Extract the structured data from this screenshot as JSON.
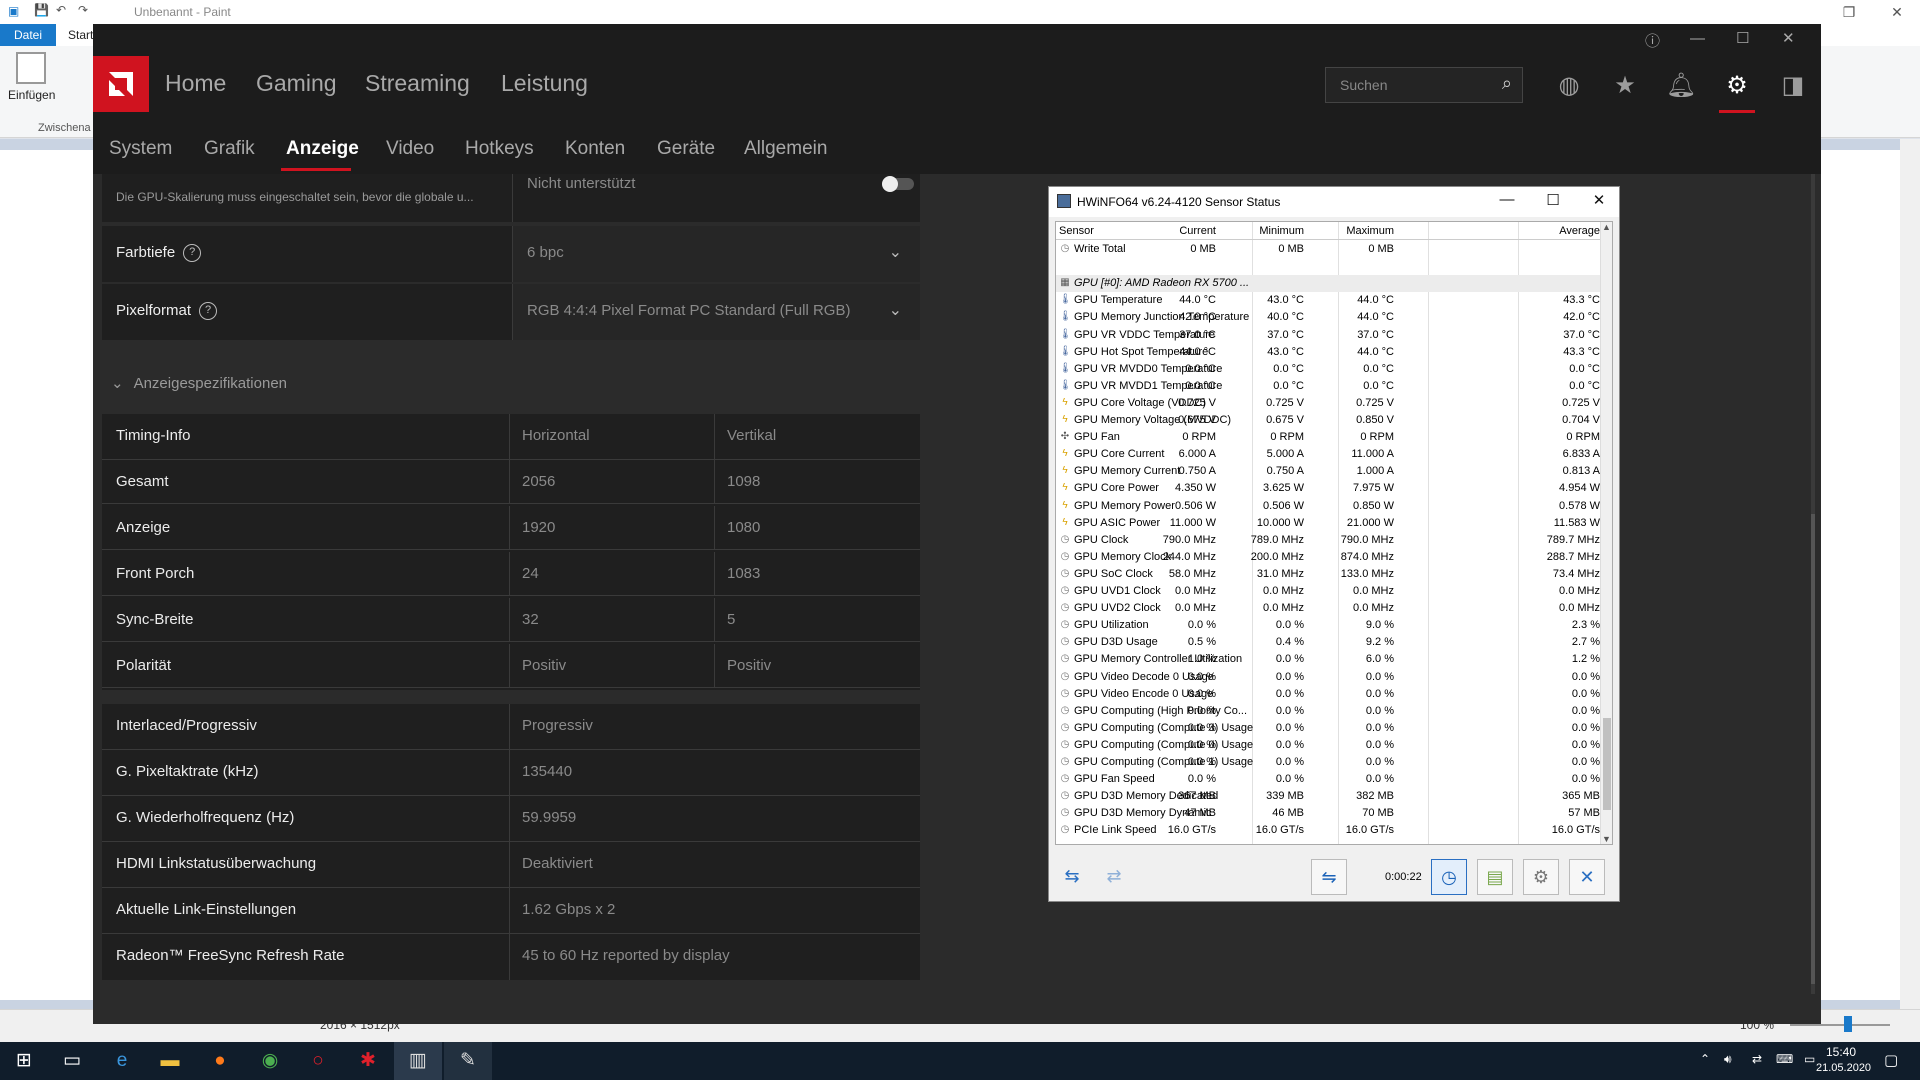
{
  "paint": {
    "title": "Unbenannt - Paint",
    "tab_file": "Datei",
    "tab_start": "Start",
    "paste_label": "Einfügen",
    "clipboard_label": "Zwischena",
    "status_size": "2016 × 1512px",
    "zoom": "100 %"
  },
  "amd": {
    "nav": [
      "Home",
      "Gaming",
      "Streaming",
      "Leistung"
    ],
    "search_placeholder": "Suchen",
    "subnav": [
      "System",
      "Grafik",
      "Anzeige",
      "Video",
      "Hotkeys",
      "Konten",
      "Geräte",
      "Allgemein"
    ],
    "scaling_hint": "Die GPU-Skalierung muss eingeschaltet sein, bevor die globale u...",
    "scaling_value": "Nicht unterstützt",
    "color_depth_label": "Farbtiefe",
    "color_depth_value": "6 bpc",
    "pixel_format_label": "Pixelformat",
    "pixel_format_value": "RGB 4:4:4 Pixel Format PC Standard (Full RGB)",
    "specs_header": "Anzeigespezifikationen",
    "timing": {
      "header": [
        "Timing-Info",
        "Horizontal",
        "Vertikal"
      ],
      "rows": [
        [
          "Gesamt",
          "2056",
          "1098"
        ],
        [
          "Anzeige",
          "1920",
          "1080"
        ],
        [
          "Front Porch",
          "24",
          "1083"
        ],
        [
          "Sync-Breite",
          "32",
          "5"
        ],
        [
          "Polarität",
          "Positiv",
          "Positiv"
        ]
      ]
    },
    "details": [
      [
        "Interlaced/Progressiv",
        "Progressiv"
      ],
      [
        "G. Pixeltaktrate (kHz)",
        "135440"
      ],
      [
        "G. Wiederholfrequenz (Hz)",
        "59.9959"
      ],
      [
        "HDMI Linkstatusüberwachung",
        "Deaktiviert"
      ],
      [
        "Aktuelle Link-Einstellungen",
        "1.62 Gbps x 2"
      ],
      [
        "Radeon™ FreeSync Refresh Rate",
        "45 to 60 Hz reported by display"
      ]
    ]
  },
  "hwinfo": {
    "title": "HWiNFO64 v6.24-4120 Sensor Status",
    "columns": [
      "Sensor",
      "Current",
      "Minimum",
      "Maximum",
      "Average"
    ],
    "rows": [
      {
        "icon": "clock-icon",
        "name": "Write Total",
        "v": [
          "0 MB",
          "0 MB",
          "0 MB",
          ""
        ]
      },
      {
        "icon": "",
        "name": "",
        "v": [
          "",
          "",
          "",
          ""
        ]
      },
      {
        "icon": "chip-icon",
        "name": "GPU [#0]: AMD Radeon RX 5700 ...",
        "v": [
          "",
          "",
          "",
          ""
        ],
        "group": true
      },
      {
        "icon": "thermo-icon",
        "name": "GPU Temperature",
        "v": [
          "44.0 °C",
          "43.0 °C",
          "44.0 °C",
          "43.3 °C"
        ]
      },
      {
        "icon": "thermo-icon",
        "name": "GPU Memory Junction Temperature",
        "v": [
          "42.0 °C",
          "40.0 °C",
          "44.0 °C",
          "42.0 °C"
        ]
      },
      {
        "icon": "thermo-icon",
        "name": "GPU VR VDDC Temperature",
        "v": [
          "37.0 °C",
          "37.0 °C",
          "37.0 °C",
          "37.0 °C"
        ]
      },
      {
        "icon": "thermo-icon",
        "name": "GPU Hot Spot Temperature",
        "v": [
          "44.0 °C",
          "43.0 °C",
          "44.0 °C",
          "43.3 °C"
        ]
      },
      {
        "icon": "thermo-icon",
        "name": "GPU VR MVDD0 Temperature",
        "v": [
          "0.0 °C",
          "0.0 °C",
          "0.0 °C",
          "0.0 °C"
        ]
      },
      {
        "icon": "thermo-icon",
        "name": "GPU VR MVDD1 Temperature",
        "v": [
          "0.0 °C",
          "0.0 °C",
          "0.0 °C",
          "0.0 °C"
        ]
      },
      {
        "icon": "bolt-icon",
        "name": "GPU Core Voltage (VDDC)",
        "v": [
          "0.725 V",
          "0.725 V",
          "0.725 V",
          "0.725 V"
        ]
      },
      {
        "icon": "bolt-icon",
        "name": "GPU Memory Voltage (MVDDC)",
        "v": [
          "0.675 V",
          "0.675 V",
          "0.850 V",
          "0.704 V"
        ]
      },
      {
        "icon": "fan-icon",
        "name": "GPU Fan",
        "v": [
          "0 RPM",
          "0 RPM",
          "0 RPM",
          "0 RPM"
        ]
      },
      {
        "icon": "bolt-icon",
        "name": "GPU Core Current",
        "v": [
          "6.000 A",
          "5.000 A",
          "11.000 A",
          "6.833 A"
        ]
      },
      {
        "icon": "bolt-icon",
        "name": "GPU Memory Current",
        "v": [
          "0.750 A",
          "0.750 A",
          "1.000 A",
          "0.813 A"
        ]
      },
      {
        "icon": "bolt-icon",
        "name": "GPU Core Power",
        "v": [
          "4.350 W",
          "3.625 W",
          "7.975 W",
          "4.954 W"
        ]
      },
      {
        "icon": "bolt-icon",
        "name": "GPU Memory Power",
        "v": [
          "0.506 W",
          "0.506 W",
          "0.850 W",
          "0.578 W"
        ]
      },
      {
        "icon": "bolt-icon",
        "name": "GPU ASIC Power",
        "v": [
          "11.000 W",
          "10.000 W",
          "21.000 W",
          "11.583 W"
        ]
      },
      {
        "icon": "clock-icon",
        "name": "GPU Clock",
        "v": [
          "790.0 MHz",
          "789.0 MHz",
          "790.0 MHz",
          "789.7 MHz"
        ]
      },
      {
        "icon": "clock-icon",
        "name": "GPU Memory Clock",
        "v": [
          "244.0 MHz",
          "200.0 MHz",
          "874.0 MHz",
          "288.7 MHz"
        ]
      },
      {
        "icon": "clock-icon",
        "name": "GPU SoC Clock",
        "v": [
          "58.0 MHz",
          "31.0 MHz",
          "133.0 MHz",
          "73.4 MHz"
        ]
      },
      {
        "icon": "clock-icon",
        "name": "GPU UVD1 Clock",
        "v": [
          "0.0 MHz",
          "0.0 MHz",
          "0.0 MHz",
          "0.0 MHz"
        ]
      },
      {
        "icon": "clock-icon",
        "name": "GPU UVD2 Clock",
        "v": [
          "0.0 MHz",
          "0.0 MHz",
          "0.0 MHz",
          "0.0 MHz"
        ]
      },
      {
        "icon": "clock-icon",
        "name": "GPU Utilization",
        "v": [
          "0.0 %",
          "0.0 %",
          "9.0 %",
          "2.3 %"
        ]
      },
      {
        "icon": "clock-icon",
        "name": "GPU D3D Usage",
        "v": [
          "0.5 %",
          "0.4 %",
          "9.2 %",
          "2.7 %"
        ]
      },
      {
        "icon": "clock-icon",
        "name": "GPU Memory Controller Utilization",
        "v": [
          "1.0 %",
          "0.0 %",
          "6.0 %",
          "1.2 %"
        ]
      },
      {
        "icon": "clock-icon",
        "name": "GPU Video Decode 0 Usage",
        "v": [
          "0.0 %",
          "0.0 %",
          "0.0 %",
          "0.0 %"
        ]
      },
      {
        "icon": "clock-icon",
        "name": "GPU Video Encode 0 Usage",
        "v": [
          "0.0 %",
          "0.0 %",
          "0.0 %",
          "0.0 %"
        ]
      },
      {
        "icon": "clock-icon",
        "name": "GPU Computing (High Priority Co...",
        "v": [
          "0.0 %",
          "0.0 %",
          "0.0 %",
          "0.0 %"
        ]
      },
      {
        "icon": "clock-icon",
        "name": "GPU Computing (Compute 3) Usage",
        "v": [
          "0.0 %",
          "0.0 %",
          "0.0 %",
          "0.0 %"
        ]
      },
      {
        "icon": "clock-icon",
        "name": "GPU Computing (Compute 0) Usage",
        "v": [
          "0.0 %",
          "0.0 %",
          "0.0 %",
          "0.0 %"
        ]
      },
      {
        "icon": "clock-icon",
        "name": "GPU Computing (Compute 1) Usage",
        "v": [
          "0.0 %",
          "0.0 %",
          "0.0 %",
          "0.0 %"
        ]
      },
      {
        "icon": "clock-icon",
        "name": "GPU Fan Speed",
        "v": [
          "0.0 %",
          "0.0 %",
          "0.0 %",
          "0.0 %"
        ]
      },
      {
        "icon": "clock-icon",
        "name": "GPU D3D Memory Dedicated",
        "v": [
          "367 MB",
          "339 MB",
          "382 MB",
          "365 MB"
        ]
      },
      {
        "icon": "clock-icon",
        "name": "GPU D3D Memory Dynamic",
        "v": [
          "47 MB",
          "46 MB",
          "70 MB",
          "57 MB"
        ]
      },
      {
        "icon": "clock-icon",
        "name": "PCIe Link Speed",
        "v": [
          "16.0 GT/s",
          "16.0 GT/s",
          "16.0 GT/s",
          "16.0 GT/s"
        ]
      }
    ],
    "timer": "0:00:22"
  },
  "taskbar": {
    "time": "15:40",
    "date": "21.05.2020"
  },
  "colors": {
    "amd_red": "#d0131f",
    "amd_bg": "#2b2b2b",
    "taskbar": "#101d2b"
  }
}
